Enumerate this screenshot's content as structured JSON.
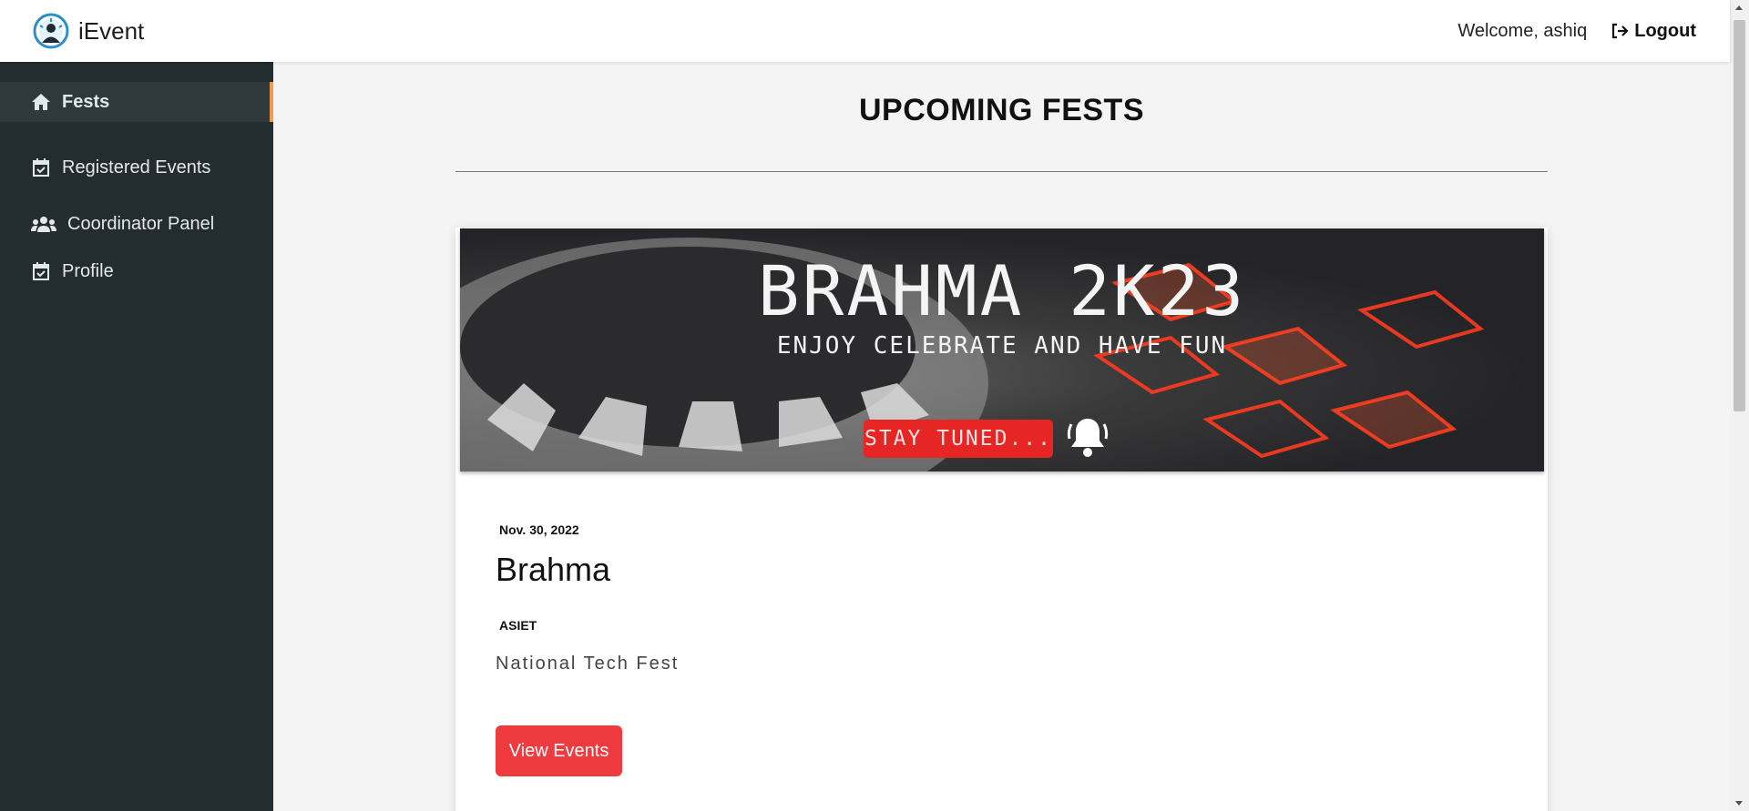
{
  "app": {
    "name": "iEvent",
    "logo_icon": "dashboard-gauge-icon"
  },
  "header": {
    "welcome": "Welcome, ashiq",
    "logout_label": "Logout",
    "logout_icon": "sign-out-icon"
  },
  "sidebar": {
    "items": [
      {
        "label": "Fests",
        "icon": "home-icon",
        "active": true
      },
      {
        "label": "Registered Events",
        "icon": "calendar-check-icon",
        "active": false
      },
      {
        "label": "Coordinator Panel",
        "icon": "users-icon",
        "active": false
      },
      {
        "label": "Profile",
        "icon": "calendar-check-icon",
        "active": false
      }
    ],
    "active_accent": "#f09a4a"
  },
  "main": {
    "title": "UPCOMING FESTS",
    "fests": [
      {
        "banner": {
          "title": "BRAHMA 2K23",
          "subtitle": "ENJOY CELEBRATE AND HAVE FUN",
          "badge": "STAY TUNED...",
          "badge_icon": "bell-icon"
        },
        "date": "Nov. 30, 2022",
        "name": "Brahma",
        "college": "ASIET",
        "description": "National Tech Fest",
        "button_label": "View Events"
      }
    ]
  },
  "colors": {
    "sidebar_bg": "#232c2f",
    "button": "#ef3b3f",
    "badge": "#e62525"
  }
}
